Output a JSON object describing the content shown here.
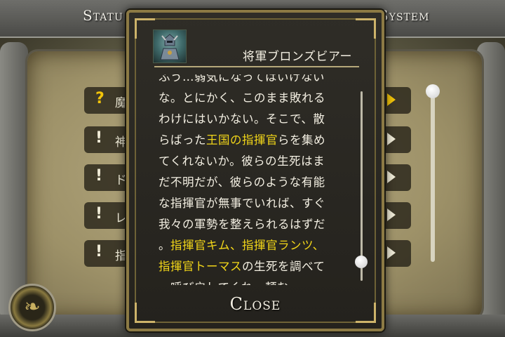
{
  "header": {
    "left_tab": "Statu",
    "right_tab": "System"
  },
  "quest_list": [
    {
      "mark": "?",
      "text": "魔",
      "mark_color": "#f2c40a"
    },
    {
      "mark": "!",
      "text": "神",
      "mark_color": "#f0ecd8"
    },
    {
      "mark": "!",
      "text": "ド",
      "mark_color": "#f0ecd8"
    },
    {
      "mark": "!",
      "text": "レ",
      "mark_color": "#f0ecd8"
    },
    {
      "mark": "!",
      "text": "指",
      "mark_color": "#f0ecd8"
    }
  ],
  "emblem": {
    "icon": "dragon-emblem-icon"
  },
  "dialog": {
    "speaker": "将軍ブロンズビアー",
    "portrait_icon": "armored-general-portrait-icon",
    "lines": [
      [
        {
          "t": "ふう…弱気になってはいけない",
          "hl": false
        }
      ],
      [
        {
          "t": "な。とにかく、このまま敗れる",
          "hl": false
        }
      ],
      [
        {
          "t": "わけにはいかない。そこで、散",
          "hl": false
        }
      ],
      [
        {
          "t": "らばった",
          "hl": false
        },
        {
          "t": "王国の指揮官",
          "hl": true
        },
        {
          "t": "らを集め",
          "hl": false
        }
      ],
      [
        {
          "t": "てくれないか。彼らの生死はま",
          "hl": false
        }
      ],
      [
        {
          "t": "だ不明だが、彼らのような有能",
          "hl": false
        }
      ],
      [
        {
          "t": "な指揮官が無事でいれば、すぐ",
          "hl": false
        }
      ],
      [
        {
          "t": "我々の軍勢を整えられるはずだ",
          "hl": false
        }
      ],
      [
        {
          "t": "。",
          "hl": false
        },
        {
          "t": "指揮官キム、指揮官ランツ、",
          "hl": true
        }
      ],
      [
        {
          "t": "指揮官トーマス",
          "hl": true
        },
        {
          "t": "の生死を調べて",
          "hl": false
        }
      ],
      [
        {
          "t": "、呼び戻してくれ。頼む。",
          "hl": false
        }
      ]
    ],
    "close_label": "Close"
  },
  "colors": {
    "highlight": "#f2d619",
    "text": "#f3efe2",
    "frame_gold": "#8c7a44"
  }
}
